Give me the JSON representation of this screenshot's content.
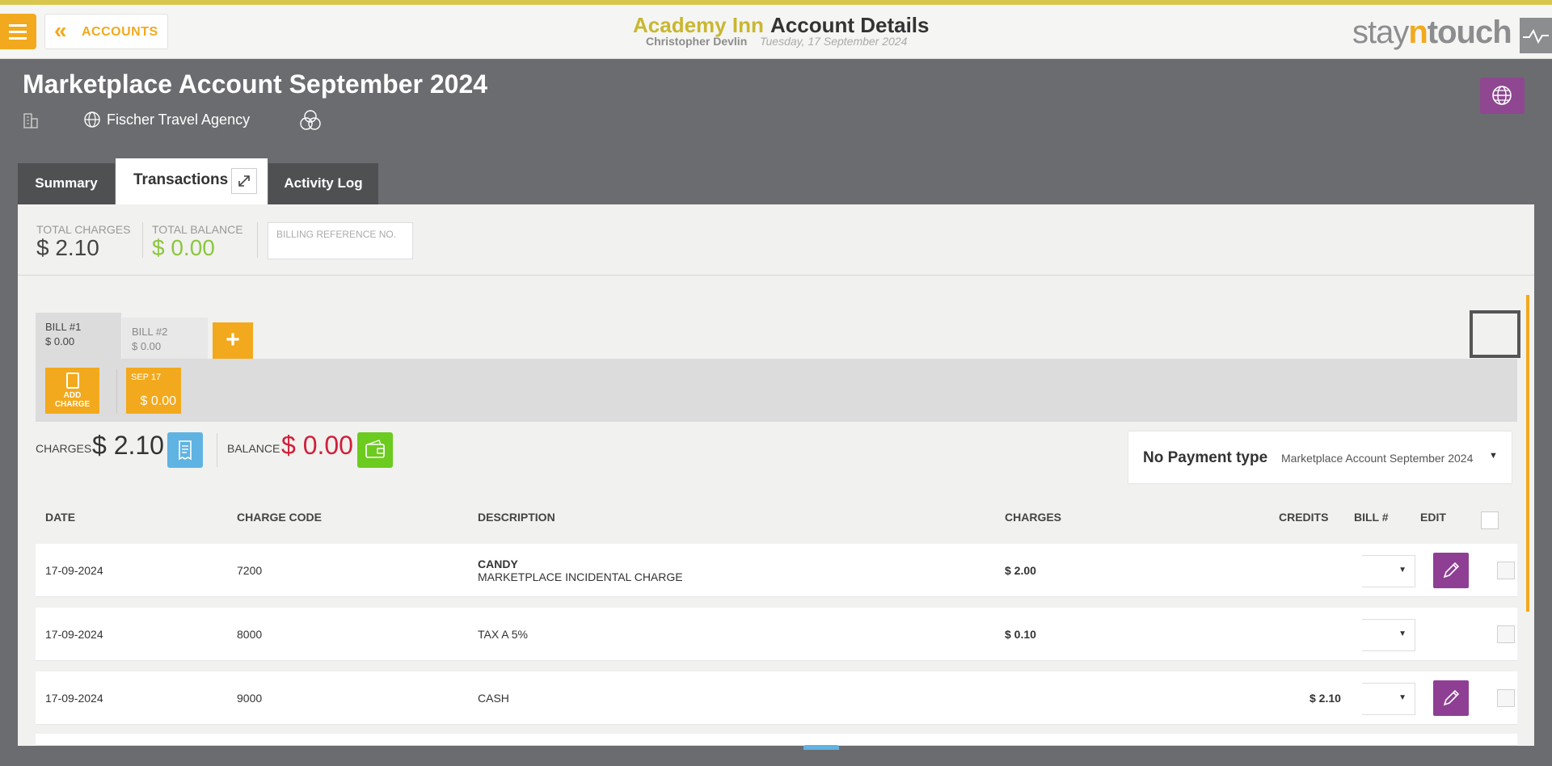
{
  "header": {
    "back_label": "ACCOUNTS",
    "hotel_name": "Academy Inn",
    "page_title": "Account Details",
    "user_name": "Christopher Devlin",
    "date": "Tuesday, 17 September 2024",
    "logo_stay": "stay",
    "logo_n": "n",
    "logo_touch": "touch"
  },
  "account": {
    "title": "Marketplace Account September 2024",
    "agency": "Fischer Travel Agency"
  },
  "tabs": {
    "summary": "Summary",
    "transactions": "Transactions",
    "activity": "Activity Log"
  },
  "totals": {
    "charges_label": "TOTAL CHARGES",
    "charges_value": "$ 2.10",
    "balance_label": "TOTAL BALANCE",
    "balance_value": "$ 0.00",
    "billref_placeholder": "BILLING REFERENCE NO."
  },
  "bills": [
    {
      "label": "BILL #1",
      "amount": "$ 0.00"
    },
    {
      "label": "BILL #2",
      "amount": "$ 0.00"
    }
  ],
  "add_bill_label": "+",
  "add_charge": {
    "line1": "ADD",
    "line2": "CHARGE"
  },
  "date_card": {
    "date": "SEP 17",
    "amount": "$ 0.00"
  },
  "summary_bar": {
    "charges_label": "CHARGES",
    "charges_value": "$ 2.10",
    "balance_label": "BALANCE",
    "balance_value": "$ 0.00"
  },
  "payment": {
    "type_label": "No Payment type",
    "selected_account": "Marketplace Account September 2024"
  },
  "table": {
    "headers": {
      "date": "DATE",
      "code": "CHARGE CODE",
      "description": "DESCRIPTION",
      "charges": "CHARGES",
      "credits": "CREDITS",
      "bill": "BILL #",
      "edit": "EDIT"
    },
    "rows": [
      {
        "date": "17-09-2024",
        "code": "7200",
        "desc_title": "CANDY",
        "desc_sub": "MARKETPLACE INCIDENTAL CHARGE",
        "charges": "$ 2.00",
        "credits": ""
      },
      {
        "date": "17-09-2024",
        "code": "8000",
        "desc_title": "",
        "desc_sub": "TAX A 5%",
        "charges": "$ 0.10",
        "credits": ""
      },
      {
        "date": "17-09-2024",
        "code": "9000",
        "desc_title": "",
        "desc_sub": "CASH",
        "charges": "",
        "credits": "$ 2.10"
      }
    ]
  },
  "colors": {
    "accent": "#f2a91d",
    "edit_purple": "#8e3f94",
    "balance_red": "#d0203a",
    "balance_green": "#8cc63f"
  }
}
